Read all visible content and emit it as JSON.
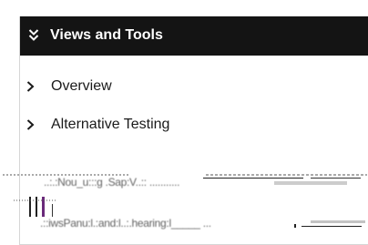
{
  "panel": {
    "title": "Views and Tools",
    "header_icon": "double-chevron-down-icon",
    "items": [
      {
        "label": "Overview",
        "icon": "chevron-right-icon"
      },
      {
        "label": "Alternative Testing",
        "icon": "chevron-right-icon"
      }
    ],
    "garbled_rows": [
      {
        "text": "..:.:Nou_u:::g  .Sap:V..:: ..........."
      },
      {
        "text": ".::iwsPanu:l.:and:l..:.hearing:l_____ ..."
      }
    ]
  },
  "colors": {
    "header_background": "#141414",
    "header_text": "#ffffff",
    "item_text": "#1a1a1a",
    "border": "#d6d6d6",
    "artifact_purple": "#6a2a7a"
  }
}
